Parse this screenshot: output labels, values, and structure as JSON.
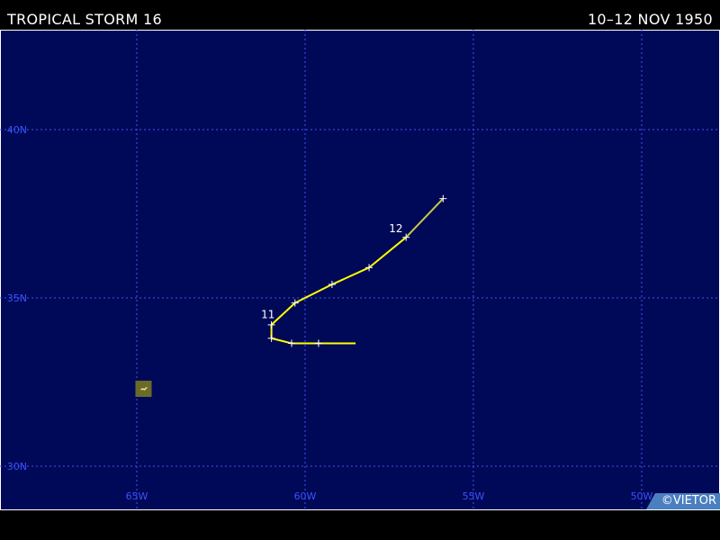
{
  "header": {
    "title": "TROPICAL STORM 16",
    "dates": "10–12 NOV 1950"
  },
  "map": {
    "background_color": "#000957",
    "grid_color": "#3b52ff",
    "track_color": "#ffff00",
    "lon_range": [
      -69,
      -48
    ],
    "lat_range": [
      29,
      42.3
    ],
    "lat_labels": [
      {
        "lat": 40,
        "text": "40N"
      },
      {
        "lat": 35,
        "text": "35N"
      },
      {
        "lat": 30,
        "text": "30N"
      }
    ],
    "lon_labels": [
      {
        "lon": -65,
        "text": "65W"
      },
      {
        "lon": -60,
        "text": "60W"
      },
      {
        "lon": -55,
        "text": "55W"
      },
      {
        "lon": -50,
        "text": "50W"
      }
    ]
  },
  "track": {
    "points": [
      {
        "lon": -58.5,
        "lat": 33.65
      },
      {
        "lon": -59.6,
        "lat": 33.65
      },
      {
        "lon": -60.4,
        "lat": 33.65
      },
      {
        "lon": -61.0,
        "lat": 33.8
      },
      {
        "lon": -61.0,
        "lat": 34.2
      },
      {
        "lon": -60.3,
        "lat": 34.85
      },
      {
        "lon": -59.2,
        "lat": 35.4
      },
      {
        "lon": -58.1,
        "lat": 35.9
      },
      {
        "lon": -57.0,
        "lat": 36.8
      },
      {
        "lon": -55.9,
        "lat": 37.95
      }
    ],
    "day_labels": [
      {
        "text": "11",
        "lon": -61.2,
        "lat": 34.4
      },
      {
        "text": "12",
        "lon": -57.4,
        "lat": 36.95
      }
    ]
  },
  "island": {
    "name_icon": "bermuda-island-icon",
    "lon": -64.8,
    "lat": 32.3
  },
  "credit": "©VIETOR"
}
